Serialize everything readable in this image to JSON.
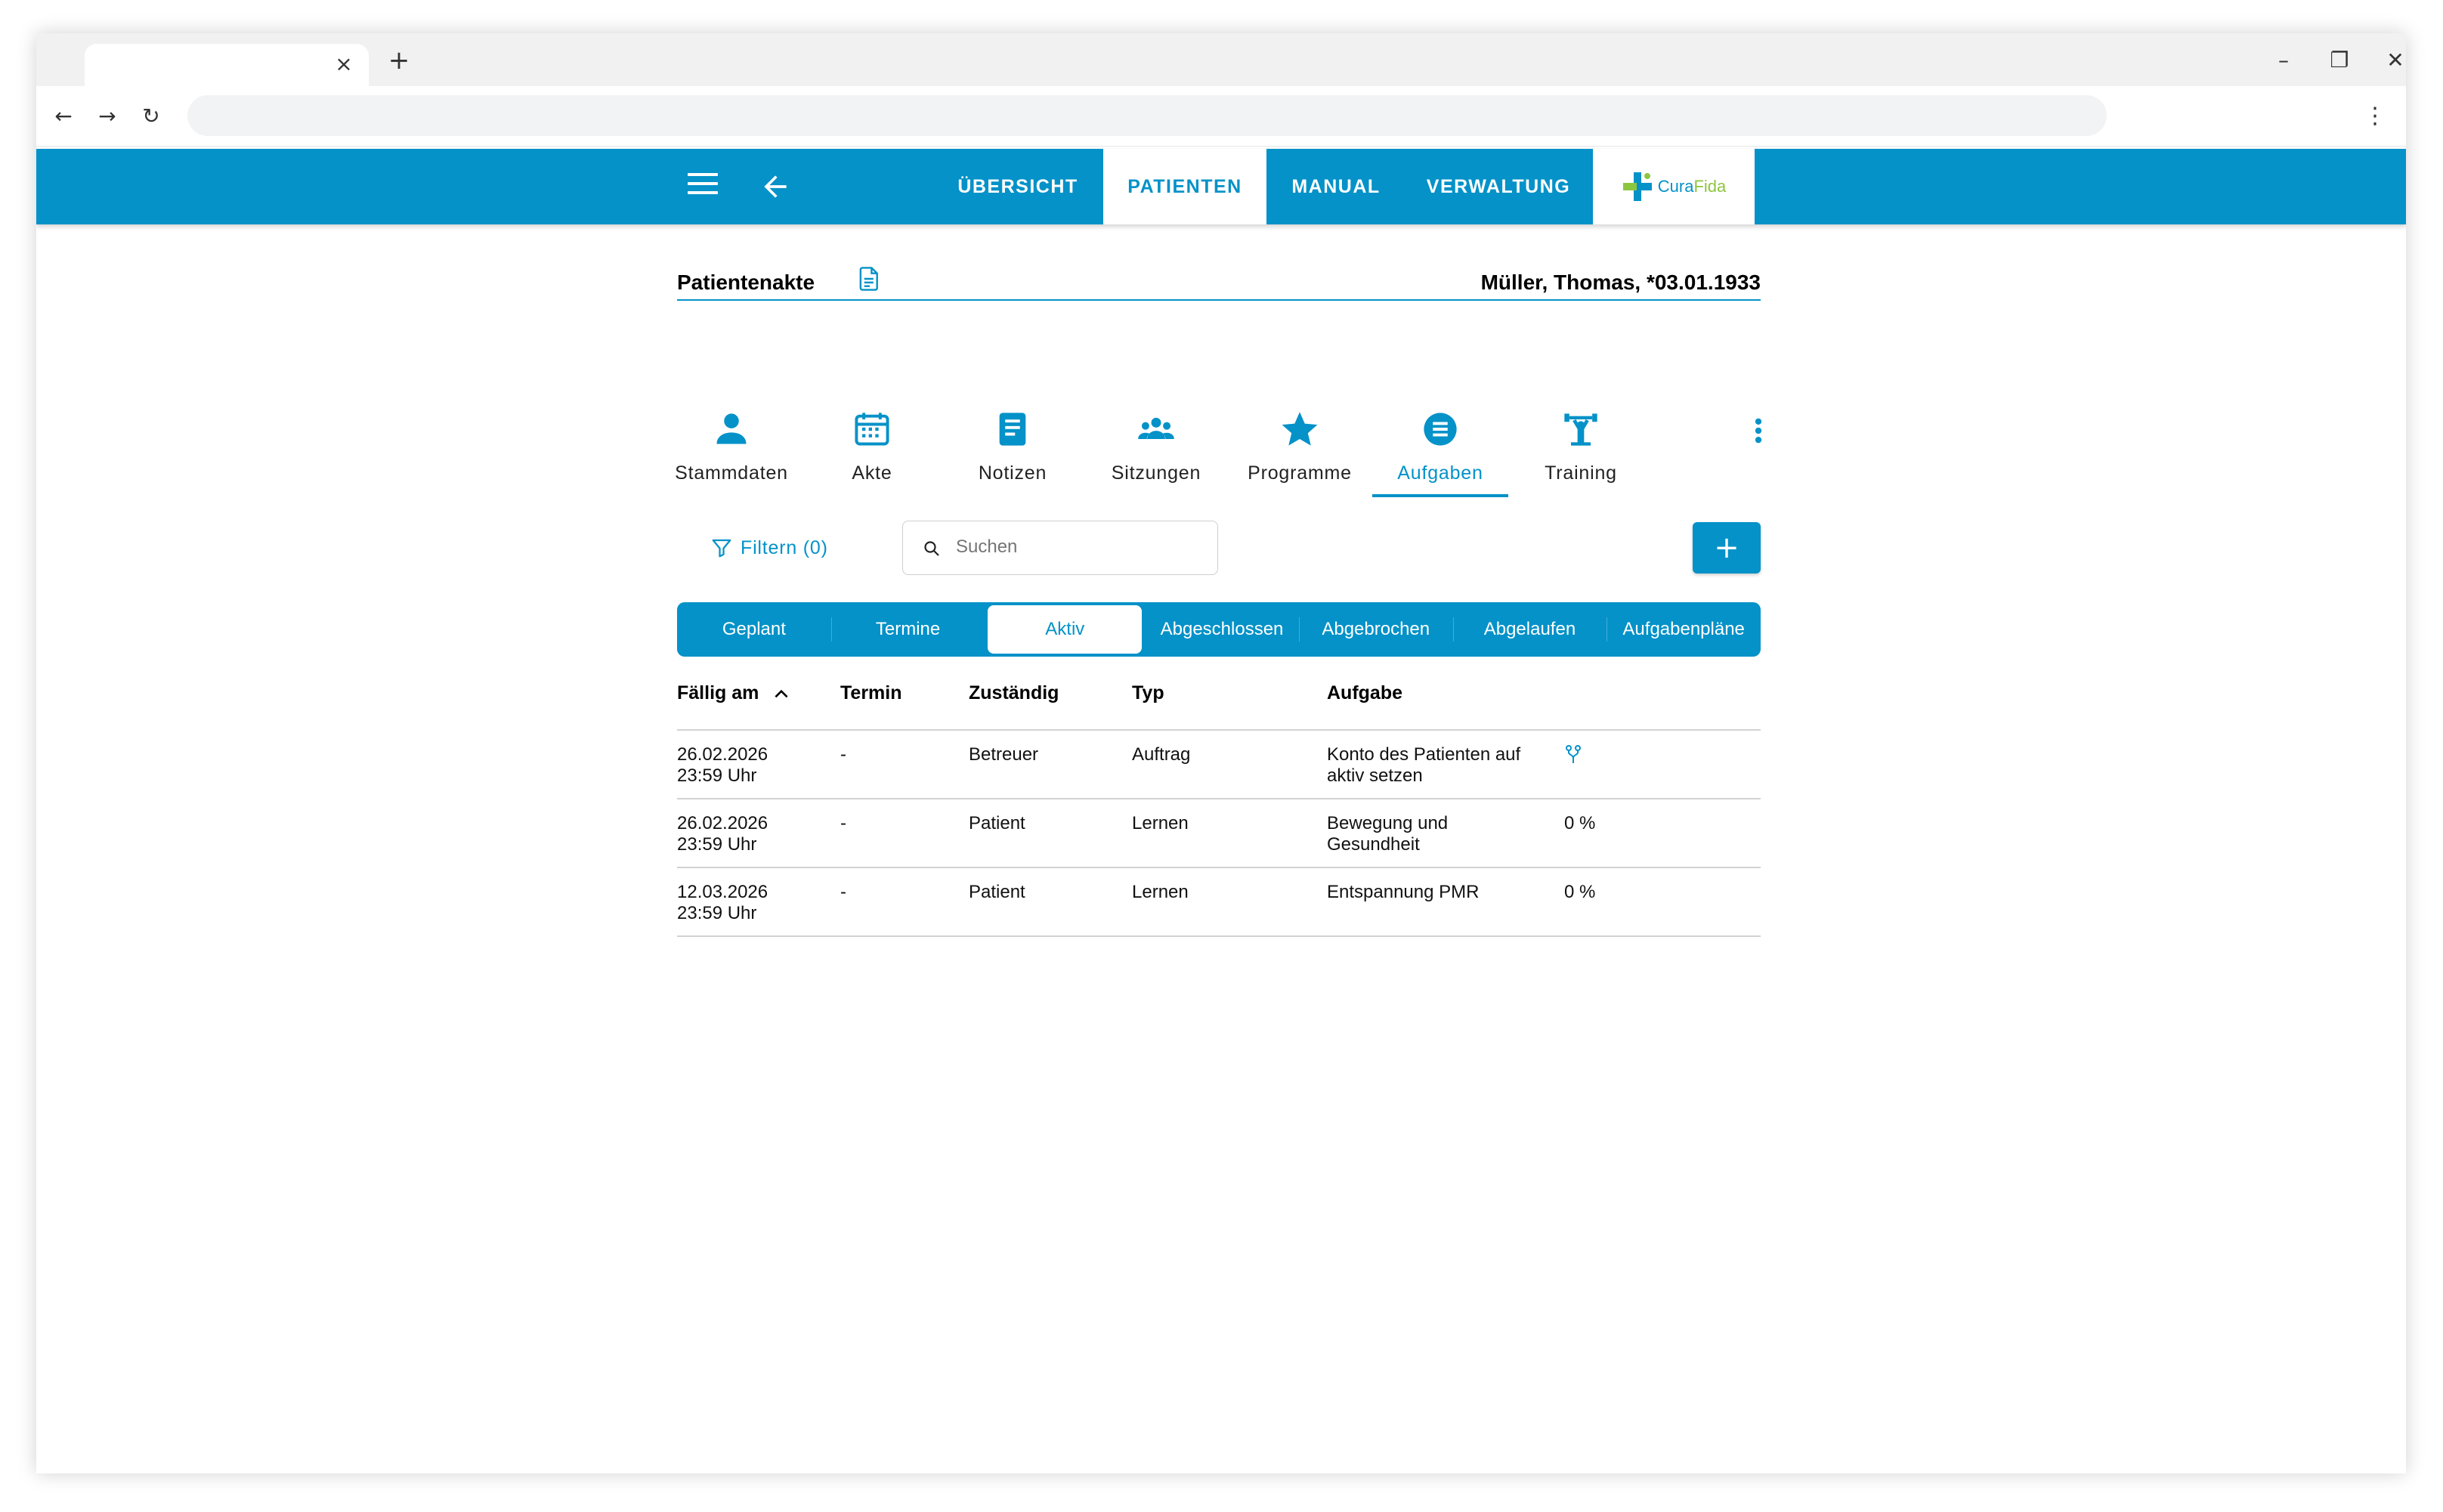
{
  "browser": {
    "tab_close": "×",
    "new_tab": "+",
    "minimize": "–",
    "restore": "❐",
    "close": "✕",
    "back": "←",
    "forward": "→",
    "reload": "↻",
    "menu": "⋮"
  },
  "header": {
    "nav": [
      {
        "label": "ÜBERSICHT",
        "active": false
      },
      {
        "label": "PATIENTEN",
        "active": true
      },
      {
        "label": "MANUAL",
        "active": false
      },
      {
        "label": "VERWALTUNG",
        "active": false
      }
    ],
    "logo": {
      "part1": "Cura",
      "part2": "Fida"
    },
    "colors": {
      "primary": "#0492c8",
      "logo_green": "#8cc63f"
    }
  },
  "record": {
    "title": "Patientenakte",
    "patient": "Müller, Thomas, *03.01.1933"
  },
  "subnav": [
    {
      "label": "Stammdaten",
      "icon": "person-icon"
    },
    {
      "label": "Akte",
      "icon": "calendar-icon"
    },
    {
      "label": "Notizen",
      "icon": "note-icon"
    },
    {
      "label": "Sitzungen",
      "icon": "group-icon"
    },
    {
      "label": "Programme",
      "icon": "star-icon"
    },
    {
      "label": "Aufgaben",
      "icon": "list-icon",
      "active": true
    },
    {
      "label": "Training",
      "icon": "fitness-icon"
    }
  ],
  "toolbar": {
    "filter_label": "Filtern (0)",
    "search_placeholder": "Suchen",
    "add_label": "+"
  },
  "status_tabs": [
    {
      "label": "Geplant"
    },
    {
      "label": "Termine"
    },
    {
      "label": "Aktiv",
      "active": true
    },
    {
      "label": "Abgeschlossen"
    },
    {
      "label": "Abgebrochen"
    },
    {
      "label": "Abgelaufen"
    },
    {
      "label": "Aufgabenpläne"
    }
  ],
  "table": {
    "columns": [
      "Fällig am",
      "Termin",
      "Zuständig",
      "Typ",
      "Aufgabe"
    ],
    "rows": [
      {
        "due_date": "26.02.2026",
        "due_time": "23:59 Uhr",
        "termin": "-",
        "zustaendig": "Betreuer",
        "typ": "Auftrag",
        "aufgabe": "Konto des Patienten auf aktiv setzen",
        "extra": "",
        "extra_icon": "fork-icon"
      },
      {
        "due_date": "26.02.2026",
        "due_time": "23:59 Uhr",
        "termin": "-",
        "zustaendig": "Patient",
        "typ": "Lernen",
        "aufgabe": "Bewegung und Gesundheit",
        "extra": "0 %"
      },
      {
        "due_date": "12.03.2026",
        "due_time": "23:59 Uhr",
        "termin": "-",
        "zustaendig": "Patient",
        "typ": "Lernen",
        "aufgabe": "Entspannung PMR",
        "extra": "0 %"
      }
    ]
  }
}
